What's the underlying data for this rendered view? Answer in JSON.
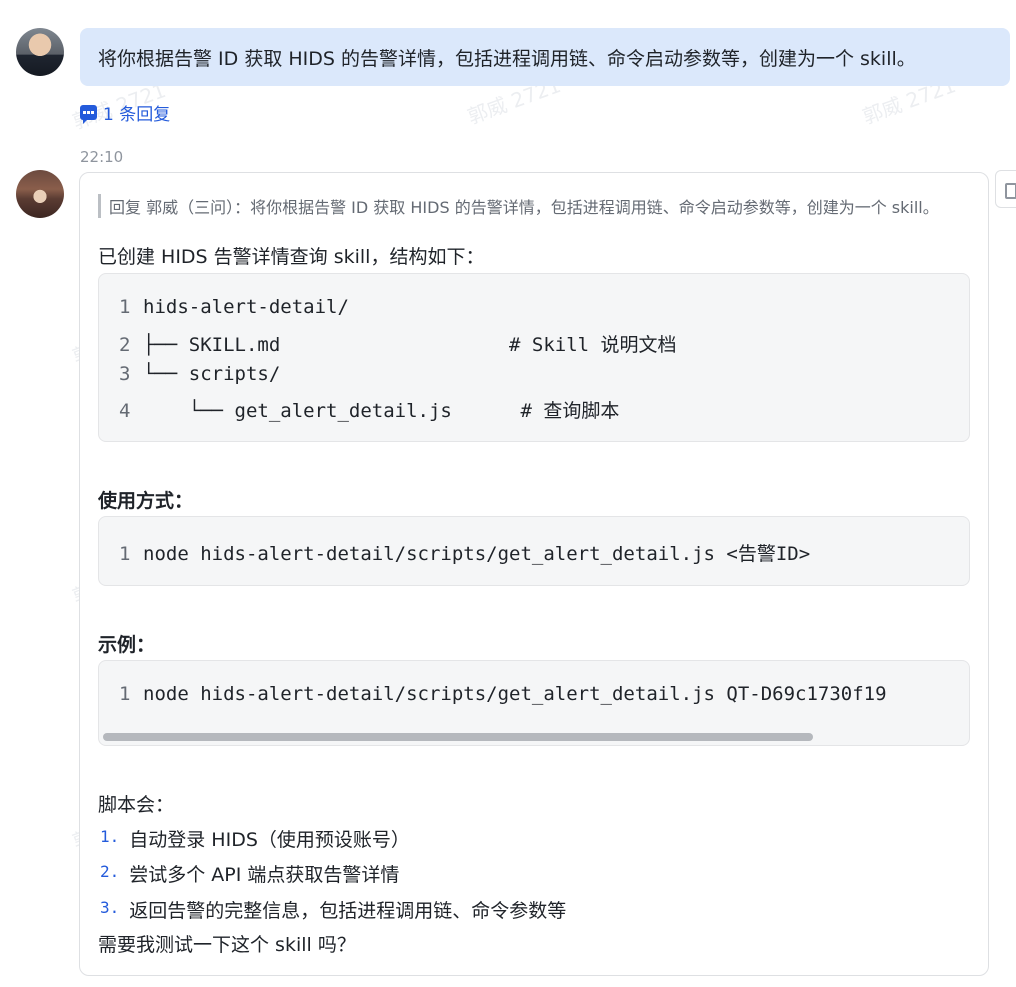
{
  "watermark_text": "郭威 2721",
  "user_message": {
    "text": "将你根据告警 ID 获取 HIDS 的告警详情，包括进程调用链、命令启动参数等，创建为一个 skill。"
  },
  "thread": {
    "reply_count_label": "1 条回复",
    "reply_icon": "comment-bubble-icon"
  },
  "bot_message": {
    "timestamp": "22:10",
    "quote": "回复 郭威（三问）：将你根据告警 ID 获取 HIDS 的告警详情，包括进程调用链、命令启动参数等，创建为一个 skill。",
    "intro": "已创建 HIDS 告警详情查询 skill，结构如下：",
    "structure_lines": [
      {
        "num": "1",
        "text": "hids-alert-detail/"
      },
      {
        "num": "2",
        "text": "├── SKILL.md                    # Skill 说明文档"
      },
      {
        "num": "3",
        "text": "└── scripts/"
      },
      {
        "num": "4",
        "text": "    └── get_alert_detail.js      # 查询脚本"
      }
    ],
    "usage_heading": "使用方式：",
    "usage_lines": [
      {
        "num": "1",
        "text": "node hids-alert-detail/scripts/get_alert_detail.js <告警ID>"
      }
    ],
    "example_heading": "示例：",
    "example_lines": [
      {
        "num": "1",
        "text": "node hids-alert-detail/scripts/get_alert_detail.js QT-D69c1730f19"
      }
    ],
    "script_heading": "脚本会：",
    "steps": [
      {
        "num": "1.",
        "text": "自动登录 HIDS（使用预设账号）"
      },
      {
        "num": "2.",
        "text": "尝试多个 API 端点获取告警详情"
      },
      {
        "num": "3.",
        "text": "返回告警的完整信息，包括进程调用链、命令参数等"
      }
    ],
    "closing": "需要我测试一下这个 skill 吗？"
  },
  "side_action_icon": "thumbs-up-icon",
  "colors": {
    "user_bubble": "#dbe8fb",
    "link": "#245bdb",
    "code_bg": "#f5f6f7"
  }
}
